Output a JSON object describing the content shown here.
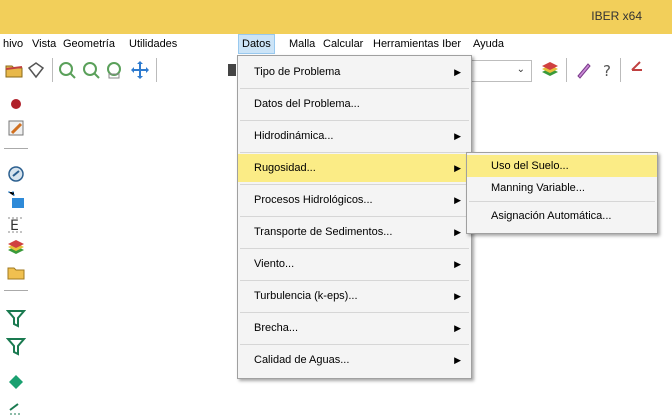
{
  "app": {
    "title": "IBER x64"
  },
  "menubar": {
    "items": [
      "hivo",
      "Vista",
      "Geometría",
      "Utilidades",
      "Datos",
      "Malla",
      "Calcular",
      "Herramientas Iber",
      "Ayuda"
    ],
    "active": "Datos"
  },
  "datos_menu": {
    "items": [
      {
        "label": "Tipo de Problema",
        "submenu": true
      },
      {
        "label": "Datos del Problema...",
        "submenu": false
      },
      {
        "label": "Hidrodinámica...",
        "submenu": true
      },
      {
        "label": "Rugosidad...",
        "submenu": true,
        "highlighted": true
      },
      {
        "label": "Procesos Hidrológicos...",
        "submenu": true
      },
      {
        "label": "Transporte de Sedimentos...",
        "submenu": true
      },
      {
        "label": "Viento...",
        "submenu": true
      },
      {
        "label": "Turbulencia (k-eps)...",
        "submenu": true
      },
      {
        "label": "Brecha...",
        "submenu": true
      },
      {
        "label": "Calidad de Aguas...",
        "submenu": true
      }
    ]
  },
  "rugosidad_submenu": {
    "items": [
      {
        "label": "Uso del Suelo...",
        "highlighted": true
      },
      {
        "label": "Manning Variable..."
      },
      {
        "label": "Asignación Automática..."
      }
    ]
  },
  "toolbar": {
    "icons": [
      "folder-open-icon",
      "save-icon",
      "zoom-in-icon",
      "zoom-out-icon",
      "zoom-frame-icon",
      "pan-icon",
      "layers-icon",
      "render-icon",
      "help-icon",
      "more-icon"
    ]
  },
  "leftbar": {
    "icons": [
      "point-icon",
      "edit-icon",
      "surface-icon",
      "mesh-icon",
      "label-icon",
      "layers-icon",
      "folder-icon",
      "funnel-icon",
      "funnel-icon",
      "diamond-icon",
      "arrow-icon"
    ]
  },
  "colors": {
    "titlebar": "#f2cf5a",
    "highlight": "#fbec86",
    "menubar_active": "#cce4f7"
  }
}
